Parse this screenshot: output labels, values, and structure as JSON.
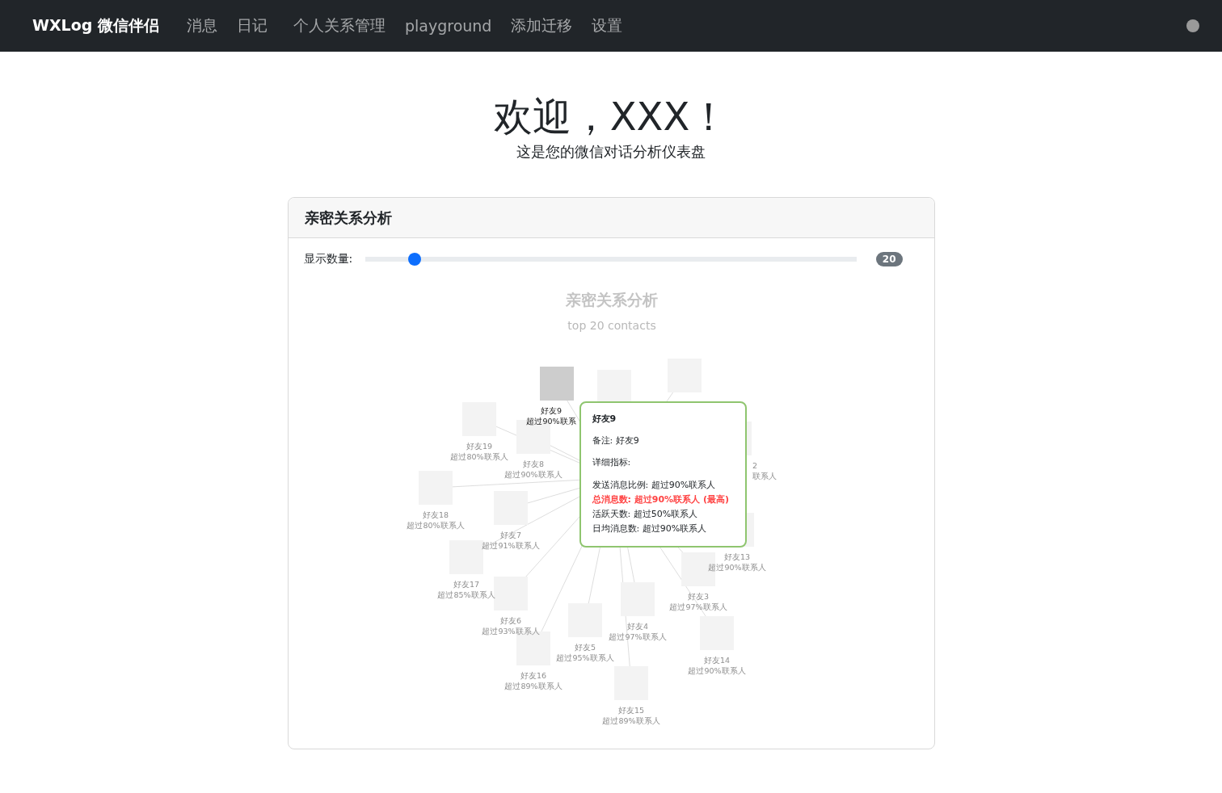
{
  "navbar": {
    "brand": "WXLog 微信伴侣",
    "items": [
      {
        "label": "消息"
      },
      {
        "label": "日记"
      },
      {
        "label": "个人关系管理"
      },
      {
        "label": "playground"
      },
      {
        "label": "添加迁移"
      },
      {
        "label": "设置"
      }
    ]
  },
  "welcome": {
    "title": "欢迎，XXX！",
    "subtitle": "这是您的微信对话分析仪表盘"
  },
  "card": {
    "title": "亲密关系分析",
    "slider": {
      "label": "显示数量:",
      "level": 0.1,
      "value": "20"
    },
    "chart": {
      "title": "亲密关系分析",
      "subtitle": "top 20 contacts",
      "nodes": [
        {
          "name": "好友9",
          "rank": "超过90%联系",
          "highlighted": true
        },
        {
          "highlighted": false
        },
        {
          "highlighted": false
        },
        {
          "name": "2",
          "rank": "联系人",
          "highlighted": false
        },
        {
          "name": "好友19",
          "rank": "超过80%联系人",
          "highlighted": false
        },
        {
          "name": "好友8",
          "rank": "超过90%联系人",
          "highlighted": false
        },
        {
          "name": "好友18",
          "rank": "超过80%联系人",
          "highlighted": false
        },
        {
          "name": "好友7",
          "rank": "超过91%联系人",
          "highlighted": false
        },
        {
          "name": "好友13",
          "rank": "超过90%联系人",
          "highlighted": false
        },
        {
          "name": "好友17",
          "rank": "超过85%联系人",
          "highlighted": false
        },
        {
          "name": "好友3",
          "rank": "超过97%联系人",
          "highlighted": false
        },
        {
          "name": "好友6",
          "rank": "超过93%联系人",
          "highlighted": false
        },
        {
          "name": "好友4",
          "rank": "超过97%联系人",
          "highlighted": false
        },
        {
          "name": "好友5",
          "rank": "超过95%联系人",
          "highlighted": false
        },
        {
          "name": "好友14",
          "rank": "超过90%联系人",
          "highlighted": false
        },
        {
          "name": "好友16",
          "rank": "超过89%联系人",
          "highlighted": false
        },
        {
          "name": "好友15",
          "rank": "超过89%联系人",
          "highlighted": false
        }
      ],
      "tooltip": {
        "title": "好友9",
        "note": "备注: 好友9",
        "section": "详细指标:",
        "metrics": [
          {
            "text": "发送消息比例: 超过90%联系人",
            "highlighted": false
          },
          {
            "text": "总消息数: 超过90%联系人 (最高)",
            "highlighted": true
          },
          {
            "text": "活跃天数: 超过50%联系人",
            "highlighted": false
          },
          {
            "text": "日均消息数: 超过90%联系人",
            "highlighted": false
          }
        ]
      }
    }
  }
}
